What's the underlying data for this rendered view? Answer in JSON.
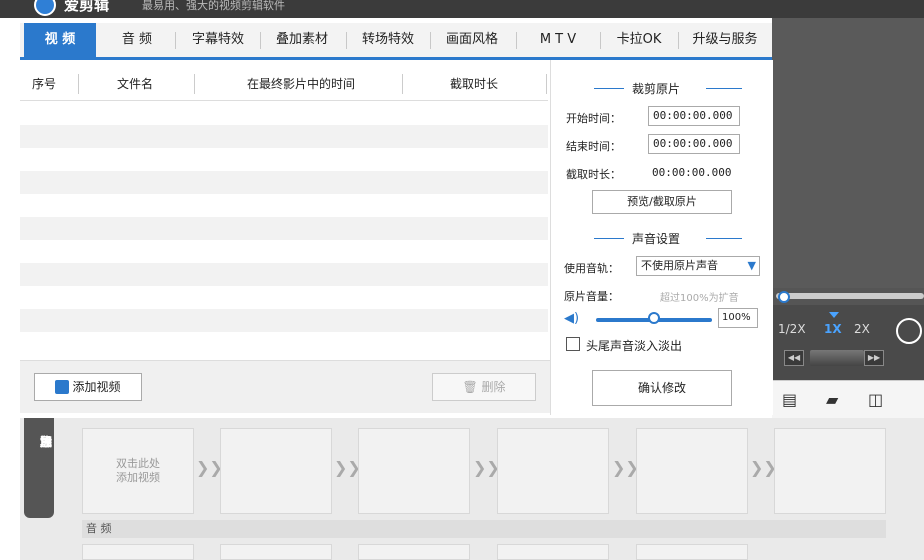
{
  "app": {
    "name": "爱剪辑",
    "slogan": "最易用、强大的视频剪辑软件"
  },
  "tabs": [
    "视 频",
    "音 频",
    "字幕特效",
    "叠加素材",
    "转场特效",
    "画面风格",
    "M T V",
    "卡拉OK",
    "升级与服务"
  ],
  "video_list": {
    "columns": [
      "序号",
      "文件名",
      "在最终影片中的时间",
      "截取时长"
    ],
    "rows": []
  },
  "buttons": {
    "add_video": "添加视频",
    "delete": "删除",
    "preview_cut": "预览/截取原片",
    "confirm": "确认修改"
  },
  "trim": {
    "title": "裁剪原片",
    "start_label": "开始时间：",
    "start_value": "00:00:00.000",
    "end_label": "结束时间：",
    "end_value": "00:00:00.000",
    "duration_label": "截取时长：",
    "duration_value": "00:00:00.000"
  },
  "audio_settings": {
    "title": "声音设置",
    "track_label": "使用音轨：",
    "track_value": "不使用原片声音",
    "volume_label": "原片音量：",
    "volume_hint": "超过100%为扩音",
    "volume_value": "100%",
    "volume_level": 0.5,
    "fade_label": "头尾声音淡入淡出",
    "fade_checked": false
  },
  "player": {
    "speeds": [
      "1/2X",
      "1X",
      "2X"
    ],
    "selected_speed": "1X",
    "step_back": "◀◀",
    "step_fwd": "▶▶"
  },
  "timeline": {
    "vertical_tab": [
      "已",
      "添",
      "加",
      "片",
      "段"
    ],
    "placeholder_line1": "双击此处",
    "placeholder_line2": "添加视频",
    "audio_label": "音 频"
  },
  "colors": {
    "accent": "#2b79cc",
    "dark_panel": "#555555"
  }
}
